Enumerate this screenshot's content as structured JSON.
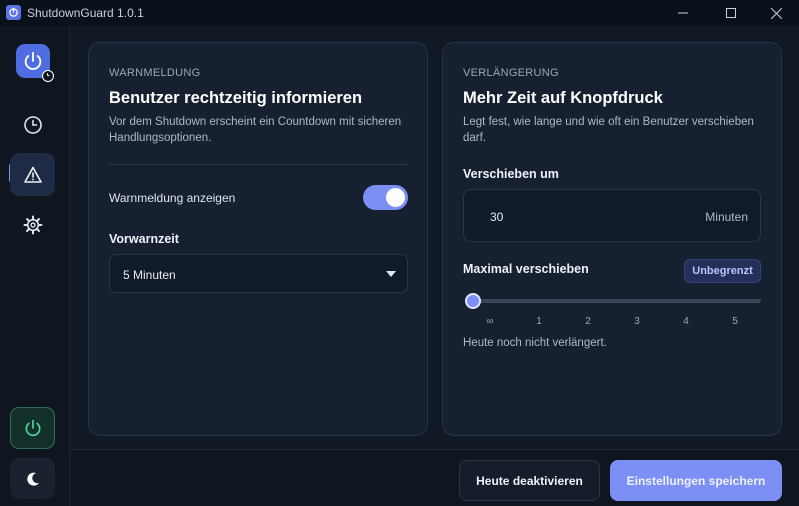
{
  "app": {
    "title": "ShutdownGuard 1.0.1"
  },
  "warning": {
    "section_label": "WARNMELDUNG",
    "title": "Benutzer rechtzeitig informieren",
    "description": "Vor dem Shutdown erscheint ein Countdown mit sicheren Handlungsoptionen.",
    "toggle_label": "Warnmeldung anzeigen",
    "toggle_on": true,
    "prewarn_label": "Vorwarnzeit",
    "prewarn_value": "5 Minuten"
  },
  "extension": {
    "section_label": "VERLÄNGERUNG",
    "title": "Mehr Zeit auf Knopfdruck",
    "description": "Legt fest, wie lange und wie oft ein Benutzer verschieben darf.",
    "postpone_label": "Verschieben um",
    "postpone_value": "30",
    "postpone_unit": "Minuten",
    "max_label": "Maximal verschieben",
    "max_badge": "Unbegrenzt",
    "slider_ticks": [
      "∞",
      "1",
      "2",
      "3",
      "4",
      "5"
    ],
    "slider_value_index": 0,
    "status": "Heute noch nicht verlängert."
  },
  "footer": {
    "deactivate_label": "Heute deaktivieren",
    "save_label": "Einstellungen speichern"
  },
  "sidebar": {
    "items": [
      {
        "icon": "clock-icon",
        "active": false
      },
      {
        "icon": "warning-icon",
        "active": true
      },
      {
        "icon": "gear-icon",
        "active": false
      }
    ]
  },
  "colors": {
    "accent": "#7b8ff5",
    "background": "#111924",
    "card": "#162030",
    "power_green": "#4fd1a0"
  }
}
